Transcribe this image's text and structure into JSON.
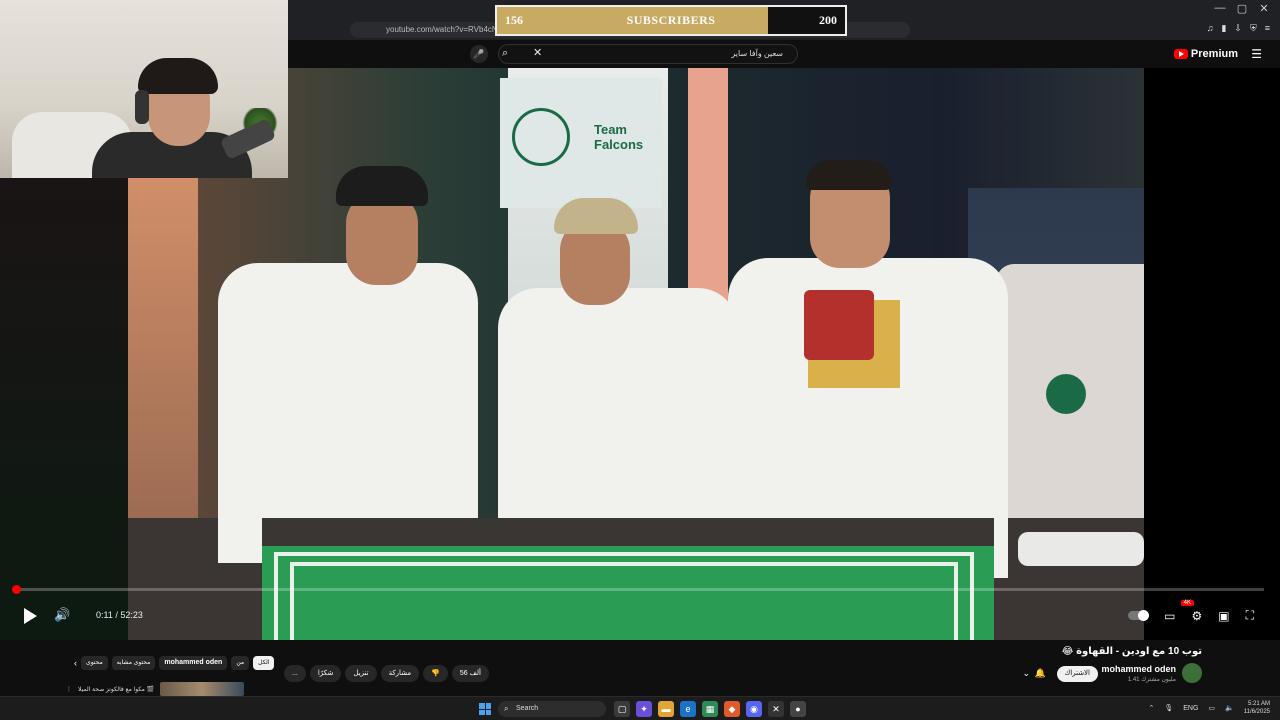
{
  "subscriber_counter": {
    "current": "156",
    "label": "SUBSCRIBERS",
    "goal": "200",
    "progress_fraction": 0.78,
    "fill_color": "#c9aa62"
  },
  "browser": {
    "url": "youtube.com/watch?v=RVb4cNs3",
    "window_controls": [
      "—",
      "▢",
      "✕"
    ]
  },
  "youtube": {
    "search_query": "سعين وآفا ساير",
    "brand": "Premium",
    "region": "SA"
  },
  "player": {
    "time": "0:11 / 52:23",
    "progress_fraction": 0.0035,
    "quality_badge": "4K"
  },
  "video": {
    "title": "توب 10 مع اودين - القهاوة 😂",
    "channel_name": "mohammed oden",
    "channel_subs": "1.41 مليون مشترك",
    "joined_label": "الاشتراك",
    "like_count": "56 ألف",
    "share_label": "مشاركة",
    "download_label": "تنزيل",
    "thanks_label": "شكرًا",
    "more_label": "..."
  },
  "chips": {
    "all": "الكل",
    "from_channel": "من",
    "channel": "mohammed oden",
    "related": "محتوى مشابه",
    "more": "محتوى"
  },
  "recommendation": {
    "title": "مكوا مع فالكونز صحة الميلا 🎬"
  },
  "taskbar": {
    "search_placeholder": "Search",
    "lang": "ENG",
    "time": "5:21 AM",
    "date": "11/6/2025"
  },
  "colors": {
    "youtube_red": "#ff0000",
    "accent_green": "#2a9c54"
  }
}
